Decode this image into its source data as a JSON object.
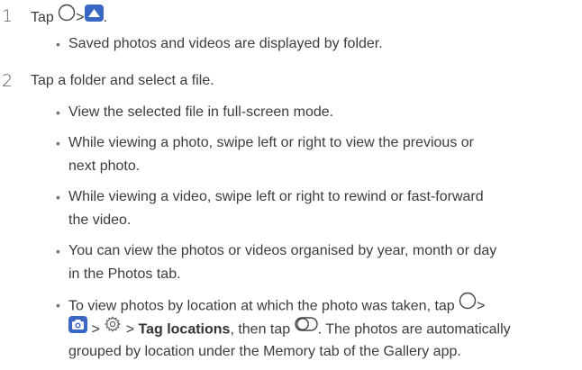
{
  "steps": [
    {
      "number": "1",
      "text_prefix": "Tap",
      "separator": ">",
      "end": ".",
      "bullets": [
        "Saved photos and videos are displayed by folder."
      ]
    },
    {
      "number": "2",
      "text": "Tap a folder and select a file.",
      "bullets": [
        "View the selected file in full-screen mode.",
        "While viewing a photo, swipe left or right to view the previous or",
        "next photo.",
        "While viewing a video, swipe left or right to rewind or fast-forward",
        "the video.",
        "You can view the photos or videos organised by year, month or day",
        "in the Photos tab."
      ],
      "last_bullet": {
        "line1_prefix": "To view photos by location at which the photo was taken, tap",
        "sep": ">",
        "bold": "Tag locations",
        "line2_mid": ", then tap",
        "line2_suffix": ". The photos are automatically",
        "line3": "grouped by location under the Memory tab of the Gallery app."
      }
    }
  ],
  "colors": {
    "gallery_icon": "#3a66c4",
    "camera_icon": "#3a66c4",
    "text": "#3c3c3c"
  },
  "icons": {
    "home": "home-circle-icon",
    "gallery": "gallery-icon",
    "camera": "camera-icon",
    "settings": "settings-gear-icon",
    "toggle": "toggle-switch-icon"
  }
}
